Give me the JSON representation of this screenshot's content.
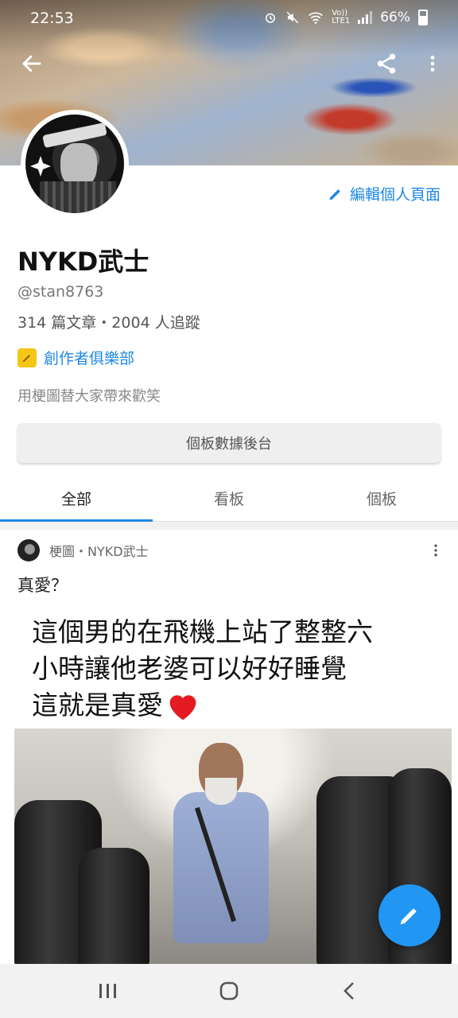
{
  "status": {
    "time": "22:53",
    "network_label": "LTE1",
    "volte_label": "Vo))",
    "battery": "66%"
  },
  "profile": {
    "name": "NYKD武士",
    "handle": "@stan8763",
    "stats": "314 篇文章・2004 人追蹤",
    "club": "創作者俱樂部",
    "bio": "用梗圖替大家帶來歡笑",
    "edit_label": "編輯個人頁面",
    "dashboard_label": "個板數據後台"
  },
  "tabs": [
    {
      "label": "全部"
    },
    {
      "label": "看板"
    },
    {
      "label": "個板"
    }
  ],
  "post": {
    "meta": "梗圖・NYKD武士",
    "title": "真愛？",
    "image_text": {
      "line1": "這個男的在飛機上站了整整六",
      "line2": "小時讓他老婆可以好好睡覺",
      "line3": "這就是真愛"
    }
  },
  "colors": {
    "accent": "#1e88e5",
    "fab": "#2196f3",
    "club_badge": "#f5c518"
  },
  "icons": {
    "back": "arrow-left",
    "share": "share",
    "more": "more-vertical",
    "edit": "pencil",
    "fab": "pencil",
    "nav_recent": "recent-apps",
    "nav_home": "home",
    "nav_back": "chevron-left"
  }
}
